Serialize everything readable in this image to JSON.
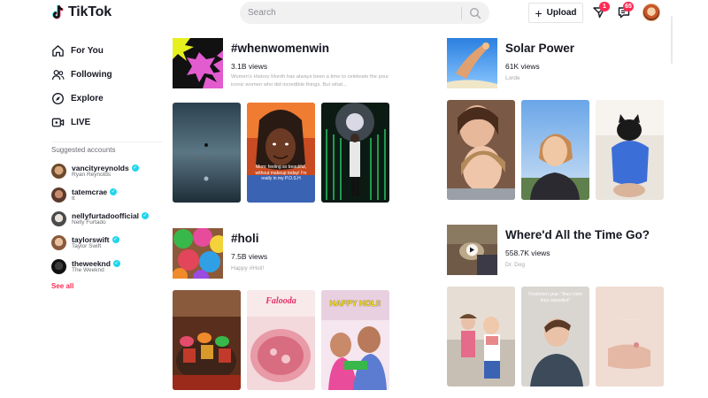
{
  "header": {
    "logo_text": "TikTok",
    "search_placeholder": "Search",
    "upload_label": "Upload",
    "inbox_badge": "1",
    "messages_badge": "65"
  },
  "sidebar": {
    "nav": [
      {
        "label": "For You",
        "icon": "home-icon"
      },
      {
        "label": "Following",
        "icon": "following-icon"
      },
      {
        "label": "Explore",
        "icon": "compass-icon"
      },
      {
        "label": "LIVE",
        "icon": "live-icon"
      }
    ],
    "suggested_title": "Suggested accounts",
    "accounts": [
      {
        "handle": "vancityreynolds",
        "name": "Ryan Reynolds"
      },
      {
        "handle": "tatemcrae",
        "name": "tt"
      },
      {
        "handle": "nellyfurtadoofficial",
        "name": "Nelly Furtado"
      },
      {
        "handle": "taylorswift",
        "name": "Taylor Swift"
      },
      {
        "handle": "theweeknd",
        "name": "The Weeknd"
      }
    ],
    "see_all": "See all"
  },
  "sections": [
    {
      "title": "#whenwomenwin",
      "views": "3.1B views",
      "description": "Women's History Month has always been a time to celebrate the pour iconic women who did incredible things. But what...",
      "videos": [
        {
          "caption": ""
        },
        {
          "caption": "Mom: feeling so beautiful, without makeup today! I'm really in my P.O.S.H"
        },
        {
          "caption": ""
        }
      ]
    },
    {
      "title": "Solar Power",
      "views": "61K views",
      "subtitle": "Lorde",
      "videos": [
        {
          "caption": ""
        },
        {
          "caption": ""
        },
        {
          "caption": ""
        }
      ]
    },
    {
      "title": "#holi",
      "views": "7.5B views",
      "subtitle": "Happy #Holi!",
      "videos": [
        {
          "caption": ""
        },
        {
          "caption": "Falooda"
        },
        {
          "caption": "HAPPY HOLI!"
        }
      ]
    },
    {
      "title": "Where'd All the Time Go?",
      "views": "558.7K views",
      "subtitle": "Dr. Dog",
      "videos": [
        {
          "caption": ""
        },
        {
          "caption": "Freshmen year: \"they room they cancelled\""
        },
        {
          "caption": ""
        }
      ]
    }
  ],
  "colors": {
    "brand": "#fe2c55",
    "verified": "#20d5ec",
    "cyan": "#25f4ee"
  }
}
